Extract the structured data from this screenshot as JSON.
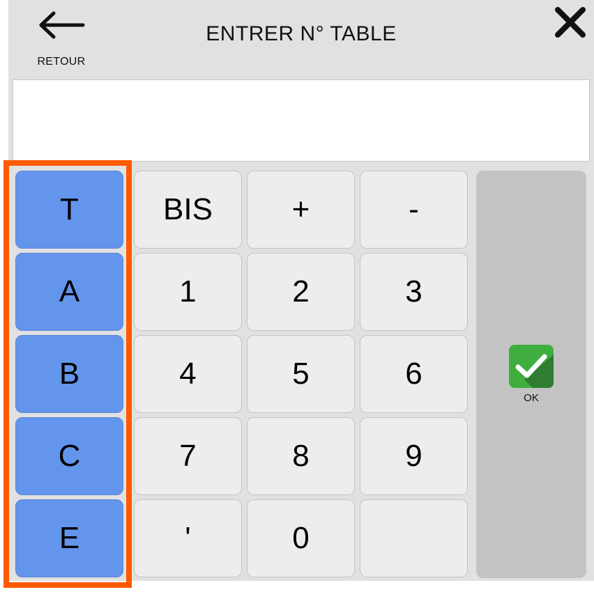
{
  "header": {
    "back_label": "RETOUR",
    "title": "ENTRER N° TABLE"
  },
  "entry": {
    "value": ""
  },
  "letters": [
    "T",
    "A",
    "B",
    "C",
    "E"
  ],
  "keypad": {
    "row1": [
      "BIS",
      "+",
      "-"
    ],
    "row2": [
      "1",
      "2",
      "3"
    ],
    "row3": [
      "4",
      "5",
      "6"
    ],
    "row4": [
      "7",
      "8",
      "9"
    ],
    "row5": [
      "'",
      "0",
      ""
    ]
  },
  "ok": {
    "label": "OK",
    "icon": "check-icon",
    "color": "#3fae3f"
  },
  "colors": {
    "letter_key": "#6495ed",
    "key": "#ededed",
    "highlight": "#ff5a00",
    "panel": "#e1e1e1"
  }
}
